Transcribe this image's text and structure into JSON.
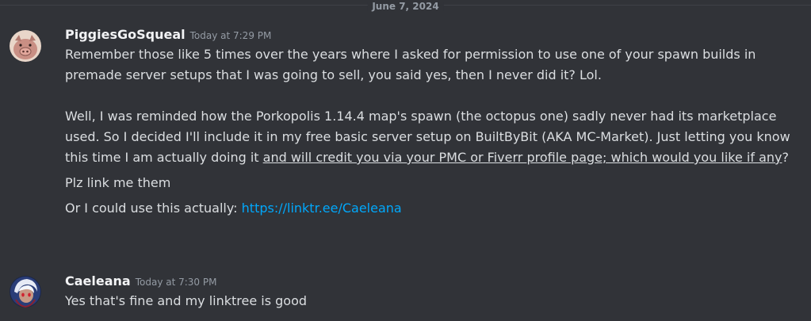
{
  "date_divider": "June 7, 2024",
  "messages": [
    {
      "author": "PiggiesGoSqueal",
      "timestamp": "Today at 7:29 PM",
      "avatar_icon": "pig-avatar-icon",
      "p1": "Remember those like 5 times over the years where I asked for permission to use one of your spawn builds in premade server setups that I was going to sell, you said yes, then I never did it? Lol.",
      "p2_plain": "Well, I was reminded how the Porkopolis 1.14.4 map's spawn (the octopus one) sadly never had its marketplace used. So I decided I'll include it in my free basic server setup on BuiltByBit (AKA MC-Market). Just letting you know this time I am actually doing it ",
      "p2_underlined": "and will credit you via your PMC or Fiverr profile page; which would you like if any",
      "p2_end": "?",
      "p3": "Plz link me them",
      "p4_prefix": "Or I could use this actually: ",
      "p4_link": "https://linktr.ee/Caeleana"
    },
    {
      "author": "Caeleana",
      "timestamp": "Today at 7:30 PM",
      "avatar_icon": "anime-avatar-icon",
      "p1": "Yes that's fine and my linktree is good"
    }
  ],
  "colors": {
    "background": "#313338",
    "text": "#dbdee1",
    "username": "#f2f3f5",
    "muted": "#949ba4",
    "link": "#00a8fc"
  }
}
